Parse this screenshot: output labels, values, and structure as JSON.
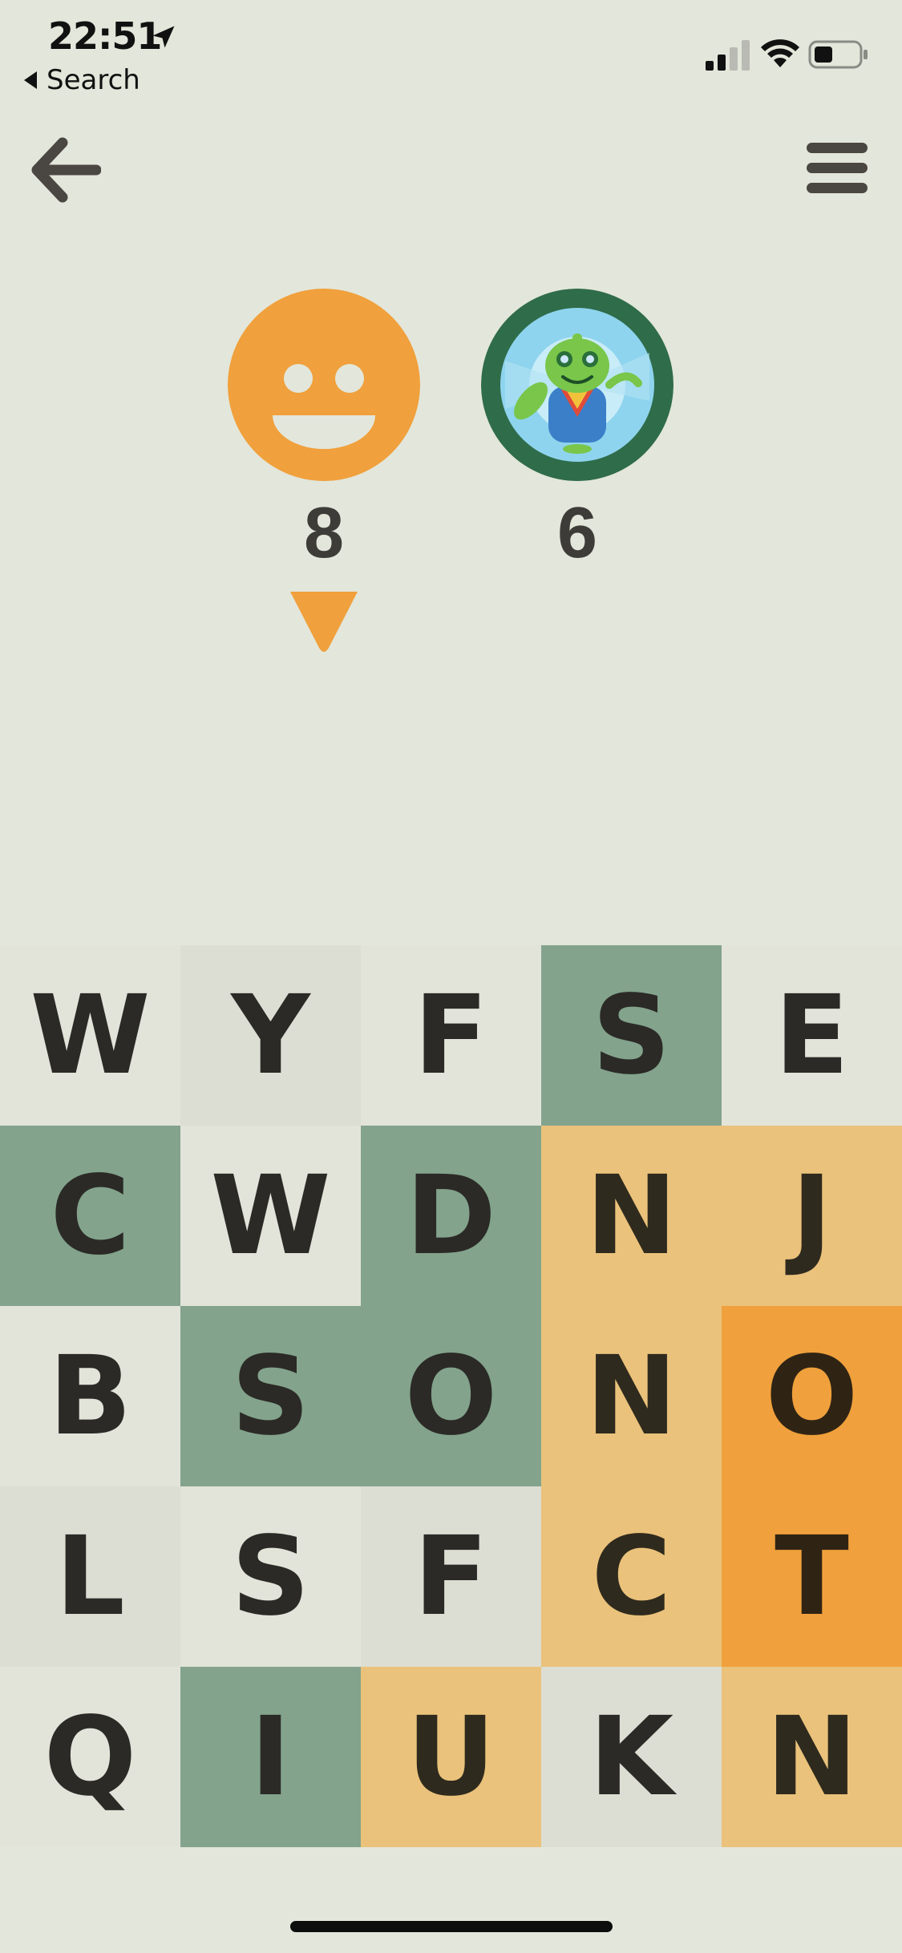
{
  "status_bar": {
    "time": "22:51",
    "back_app_label": "Search"
  },
  "nav": {
    "back_icon": "arrow-left-icon",
    "menu_icon": "hamburger-menu-icon"
  },
  "players": [
    {
      "avatar": "smiley-face-avatar",
      "score": "8",
      "color": "#f0a03c"
    },
    {
      "avatar": "robot-avatar",
      "score": "6",
      "color": "#2f6c4a"
    }
  ],
  "turn_indicator": {
    "player_index": 0,
    "color": "#f0a03c"
  },
  "colors": {
    "player1_light": "#eac27b",
    "player1_dark": "#f0a03c",
    "player2": "#83a38c",
    "neutral": "#dcded4",
    "background": "#e3e6da"
  },
  "board": [
    [
      {
        "l": "W",
        "s": "neutral-b"
      },
      {
        "l": "Y",
        "s": "neutral-a"
      },
      {
        "l": "F",
        "s": "neutral-b"
      },
      {
        "l": "S",
        "s": "green"
      },
      {
        "l": "E",
        "s": "neutral-b"
      }
    ],
    [
      {
        "l": "C",
        "s": "green"
      },
      {
        "l": "W",
        "s": "neutral-b"
      },
      {
        "l": "D",
        "s": "green"
      },
      {
        "l": "N",
        "s": "orange-light"
      },
      {
        "l": "J",
        "s": "orange-light"
      }
    ],
    [
      {
        "l": "B",
        "s": "neutral-b"
      },
      {
        "l": "S",
        "s": "green"
      },
      {
        "l": "O",
        "s": "green"
      },
      {
        "l": "N",
        "s": "orange-light"
      },
      {
        "l": "O",
        "s": "orange-dark"
      }
    ],
    [
      {
        "l": "L",
        "s": "neutral-a"
      },
      {
        "l": "S",
        "s": "neutral-b"
      },
      {
        "l": "F",
        "s": "neutral-a"
      },
      {
        "l": "C",
        "s": "orange-light"
      },
      {
        "l": "T",
        "s": "orange-dark"
      }
    ],
    [
      {
        "l": "Q",
        "s": "neutral-b"
      },
      {
        "l": "I",
        "s": "green"
      },
      {
        "l": "U",
        "s": "orange-light"
      },
      {
        "l": "K",
        "s": "neutral-a"
      },
      {
        "l": "N",
        "s": "orange-light"
      }
    ]
  ]
}
